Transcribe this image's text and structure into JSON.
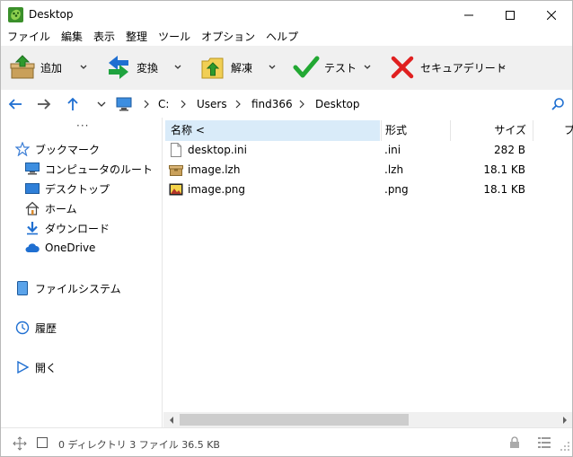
{
  "window": {
    "title": "Desktop"
  },
  "menu": [
    "ファイル",
    "編集",
    "表示",
    "整理",
    "ツール",
    "オプション",
    "ヘルプ"
  ],
  "toolbar": {
    "add_label": "追加",
    "convert_label": "変換",
    "extract_label": "解凍",
    "test_label": "テスト",
    "delete_label": "セキュアデリート"
  },
  "address": {
    "crumbs": [
      "C:",
      "Users",
      "find366",
      "Desktop"
    ]
  },
  "sidebar": {
    "more": "···",
    "bookmarks_label": "ブックマーク",
    "items": [
      {
        "label": "コンピュータのルート"
      },
      {
        "label": "デスクトップ"
      },
      {
        "label": "ホーム"
      },
      {
        "label": "ダウンロード"
      },
      {
        "label": "OneDrive"
      }
    ],
    "filesystem_label": "ファイルシステム",
    "history_label": "履歴",
    "open_label": "開く"
  },
  "filelist": {
    "columns": {
      "name": "名称 <",
      "type": "形式",
      "size": "サイズ",
      "more": "プ"
    },
    "rows": [
      {
        "name": "desktop.ini",
        "type": ".ini",
        "size": "282 B",
        "icon": "ini-file-icon"
      },
      {
        "name": "image.lzh",
        "type": ".lzh",
        "size": "18.1 KB",
        "icon": "archive-icon"
      },
      {
        "name": "image.png",
        "type": ".png",
        "size": "18.1 KB",
        "icon": "image-file-icon"
      }
    ]
  },
  "status": {
    "text": "0 ディレクトリ 3 ファイル 36.5 KB"
  },
  "colors": {
    "accent": "#0078d7",
    "header_selected": "#d9ebf9",
    "toolbar_bg": "#f0f0f0",
    "check_green": "#22a833",
    "delete_red": "#e02020"
  }
}
